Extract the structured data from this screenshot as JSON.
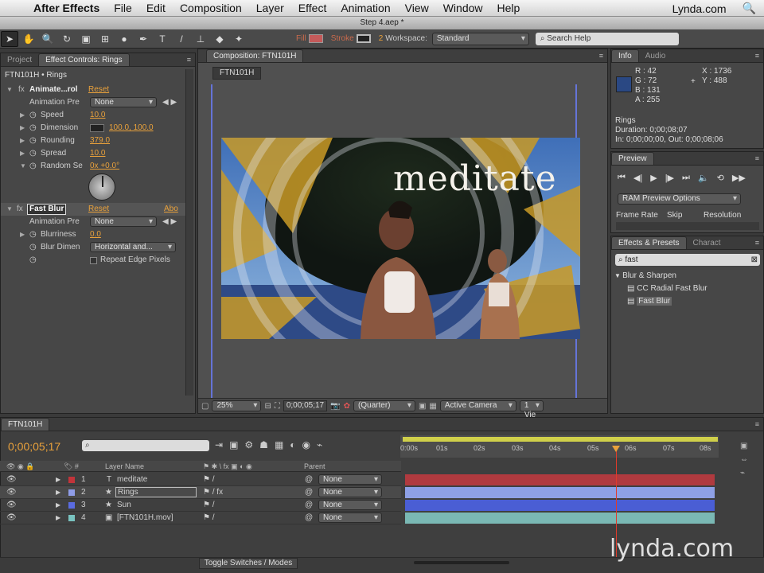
{
  "menubar": {
    "app": "After Effects",
    "items": [
      "File",
      "Edit",
      "Composition",
      "Layer",
      "Effect",
      "Animation",
      "View",
      "Window",
      "Help"
    ],
    "right": "Lynda.com"
  },
  "window_title": "Step 4.aep *",
  "toolbar": {
    "fill_label": "Fill",
    "stroke_label": "Stroke",
    "stroke_width": "2",
    "workspace_label": "Workspace:",
    "workspace_value": "Standard",
    "search_placeholder": "Search Help"
  },
  "left_panel": {
    "tabs": [
      "Project",
      "Effect Controls: Rings"
    ],
    "header": "FTN101H • Rings",
    "effect1": {
      "name": "Animate...rol",
      "reset": "Reset",
      "animation_preset_label": "Animation Pre",
      "animation_preset_value": "None",
      "params": [
        {
          "label": "Speed",
          "value": "10.0"
        },
        {
          "label": "Dimension",
          "value": "100.0, 100.0"
        },
        {
          "label": "Rounding",
          "value": "379.0"
        },
        {
          "label": "Spread",
          "value": "10.0"
        },
        {
          "label": "Random Se",
          "value": "0x +0.0°"
        }
      ]
    },
    "effect2": {
      "name": "Fast Blur",
      "reset": "Reset",
      "about": "Abo",
      "animation_preset_label": "Animation Pre",
      "animation_preset_value": "None",
      "blurriness_label": "Blurriness",
      "blurriness_value": "0.0",
      "blur_dim_label": "Blur Dimen",
      "blur_dim_value": "Horizontal and...",
      "repeat_label": "Repeat Edge Pixels"
    }
  },
  "comp_panel": {
    "tab": "Composition: FTN101H",
    "comp_name": "FTN101H",
    "overlay_text": "meditate",
    "zoom": "25%",
    "timecode": "0;00;05;17",
    "resolution": "(Quarter)",
    "camera": "Active Camera",
    "views": "1 Vie"
  },
  "info_panel": {
    "tabs": [
      "Info",
      "Audio"
    ],
    "r": "R : 42",
    "g": "G : 72",
    "b": "B : 131",
    "a": "A : 255",
    "x": "X : 1736",
    "y": "Y : 488",
    "layer": "Rings",
    "duration": "Duration: 0;00;08;07",
    "inout": "In: 0;00;00;00, Out: 0;00;08;06",
    "swatch_color": "#2a4883"
  },
  "preview_panel": {
    "tab": "Preview",
    "ram_preview": "RAM Preview Options",
    "frame_rate": "Frame Rate",
    "skip": "Skip",
    "resolution": "Resolution"
  },
  "effects_panel": {
    "tabs": [
      "Effects & Presets",
      "Charact"
    ],
    "search_value": "fast",
    "category": "Blur & Sharpen",
    "items": [
      "CC Radial Fast Blur",
      "Fast Blur"
    ]
  },
  "timeline": {
    "tab": "FTN101H",
    "timecode": "0;00;05;17",
    "col_layer_name": "Layer Name",
    "col_parent": "Parent",
    "ruler": [
      "0:00s",
      "01s",
      "02s",
      "03s",
      "04s",
      "05s",
      "06s",
      "07s",
      "08s"
    ],
    "current_time_fraction": 0.68,
    "layers": [
      {
        "num": "1",
        "name": "meditate",
        "color": "#c2343a",
        "parent": "None",
        "bar": "#b03a3f"
      },
      {
        "num": "2",
        "name": "Rings",
        "color": "#8f9de8",
        "parent": "None",
        "bar": "#8ea0e6"
      },
      {
        "num": "3",
        "name": "Sun",
        "color": "#5a6be0",
        "parent": "None",
        "bar": "#4a5ed4"
      },
      {
        "num": "4",
        "name": "[FTN101H.mov]",
        "color": "#79c3c0",
        "parent": "None",
        "bar": "#7ab8b4"
      }
    ],
    "toggle_label": "Toggle Switches / Modes"
  },
  "watermark": "lynda.com"
}
